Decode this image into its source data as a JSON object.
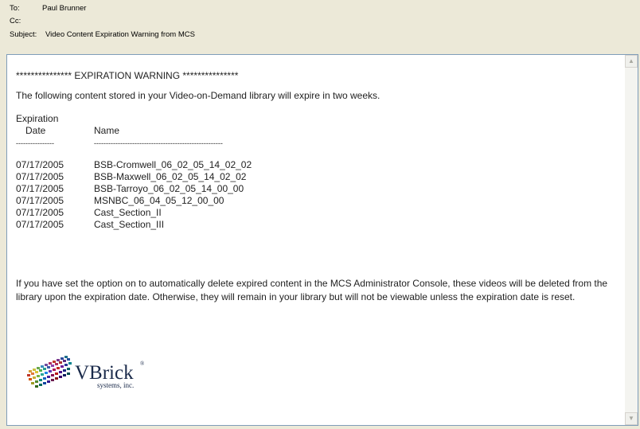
{
  "header": {
    "to_label": "To:",
    "to_value": "Paul Brunner",
    "cc_label": "Cc:",
    "cc_value": "",
    "subject_label": "Subject:",
    "subject_value": "Video Content Expiration Warning from MCS"
  },
  "message": {
    "warning_line": "*************** EXPIRATION WARNING ***************",
    "intro": "The following content stored in your Video-on-Demand library will expire in two weeks.",
    "col_date_line1": "Expiration",
    "col_date_line2": "Date",
    "col_name": "Name",
    "sep_date": "----------------",
    "sep_name": "------------------------------------------------------",
    "rows": [
      {
        "date": "07/17/2005",
        "name": "BSB-Cromwell_06_02_05_14_02_02"
      },
      {
        "date": "07/17/2005",
        "name": "BSB-Maxwell_06_02_05_14_02_02"
      },
      {
        "date": "07/17/2005",
        "name": "BSB-Tarroyo_06_02_05_14_00_00"
      },
      {
        "date": "07/17/2005",
        "name": "MSNBC_06_04_05_12_00_00"
      },
      {
        "date": "07/17/2005",
        "name": "Cast_Section_II"
      },
      {
        "date": "07/17/2005",
        "name": "Cast_Section_III"
      }
    ],
    "footer": "If you have set the option on to automatically delete expired content in the MCS Administrator Console, these videos will be deleted from the library upon the expiration date. Otherwise, they will remain in your library but will not be viewable unless the expiration date is reset."
  },
  "logo": {
    "brand": "VBrick",
    "sub": "systems, inc.",
    "mark": "®"
  },
  "icons": {
    "scroll_up": "scroll-up-arrow-icon",
    "scroll_down": "scroll-down-arrow-icon"
  },
  "colors": {
    "window_bg": "#ece9d8",
    "frame_border": "#7f9db9"
  }
}
